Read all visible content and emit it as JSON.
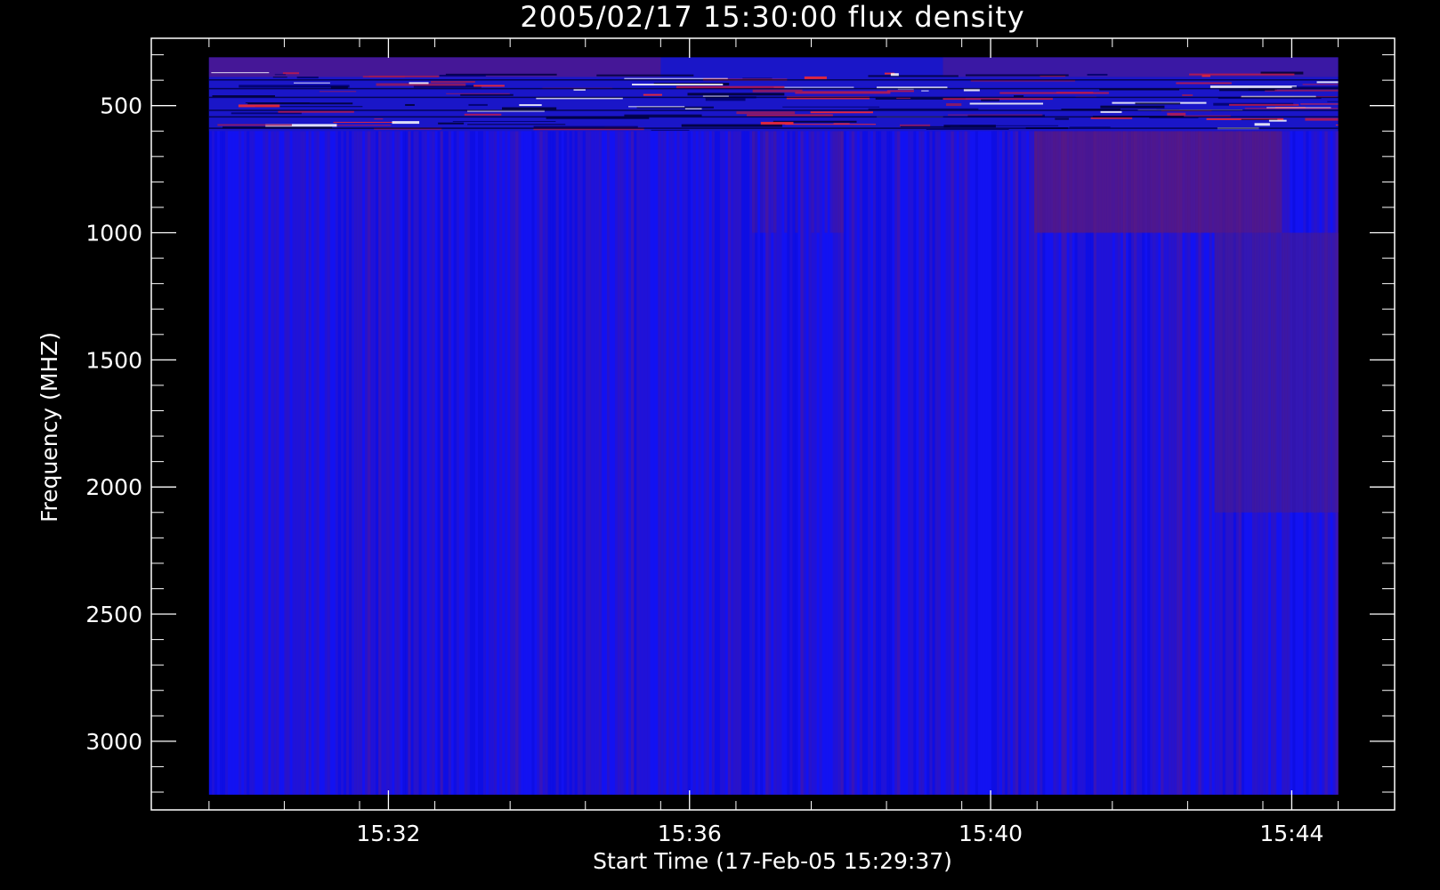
{
  "chart_data": {
    "type": "heatmap",
    "title": "2005/02/17 15:30:00 flux density",
    "xlabel": "Start Time (17-Feb-05 15:29:37)",
    "ylabel": "Frequency (MHZ)",
    "x_ticks": [
      {
        "label": "15:32",
        "minutes": 2.3833
      },
      {
        "label": "15:36",
        "minutes": 6.3833
      },
      {
        "label": "15:40",
        "minutes": 10.3833
      },
      {
        "label": "15:44",
        "minutes": 14.3833
      }
    ],
    "x_range_minutes": [
      -0.7667,
      15.75
    ],
    "data_x_range_minutes": [
      0.0,
      15.0
    ],
    "y_ticks": [
      500,
      1000,
      1500,
      2000,
      2500,
      3000
    ],
    "y_range": [
      235,
      3270
    ],
    "y_reversed": true,
    "data_y_range": [
      310,
      3210
    ],
    "colormap": [
      "#0000c0",
      "#1212f0",
      "#2b1ae0",
      "#4a1a98",
      "#7a1830",
      "#ff2020",
      "#ffffff"
    ],
    "grid": false,
    "bands": [
      {
        "freq_range": [
          310,
          600
        ],
        "description": "noisy interference band"
      },
      {
        "freq_range": [
          600,
          1000
        ],
        "description": "purple enhancement after 15:41"
      },
      {
        "freq_range": [
          1000,
          2100
        ],
        "description": "faint enhancement after 15:43"
      },
      {
        "freq_range": [
          2100,
          3210
        ],
        "description": "background"
      }
    ]
  },
  "colors": {
    "background": "#000000",
    "foreground": "#ffffff",
    "base_blue": "#1010ee"
  }
}
